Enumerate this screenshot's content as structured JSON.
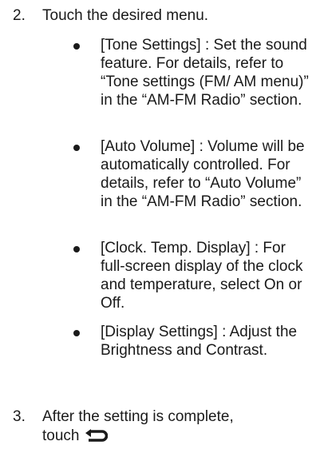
{
  "steps": [
    {
      "number": "2.",
      "text": "Touch the desired menu."
    },
    {
      "number": "3.",
      "text": "After the setting is complete,",
      "text_line2": "touch"
    }
  ],
  "bullets": [
    {
      "text": "[Tone Settings] : Set the sound feature. For details, refer to “Tone settings (FM/ AM menu)” in the “AM-FM Radio” section."
    },
    {
      "text": "[Auto Volume] : Volume will be automatically controlled. For details, refer to “Auto Volume” in the “AM-FM Radio” section."
    },
    {
      "text": "[Clock. Temp. Display] : For full-screen display of the clock and temperature, select On or Off."
    },
    {
      "text": "[Display Settings] : Adjust the Brightness and Contrast."
    }
  ],
  "icons": {
    "back": "back-arrow-icon",
    "bullet": "bullet-dot-icon"
  },
  "colors": {
    "text": "#1a1a1a"
  }
}
